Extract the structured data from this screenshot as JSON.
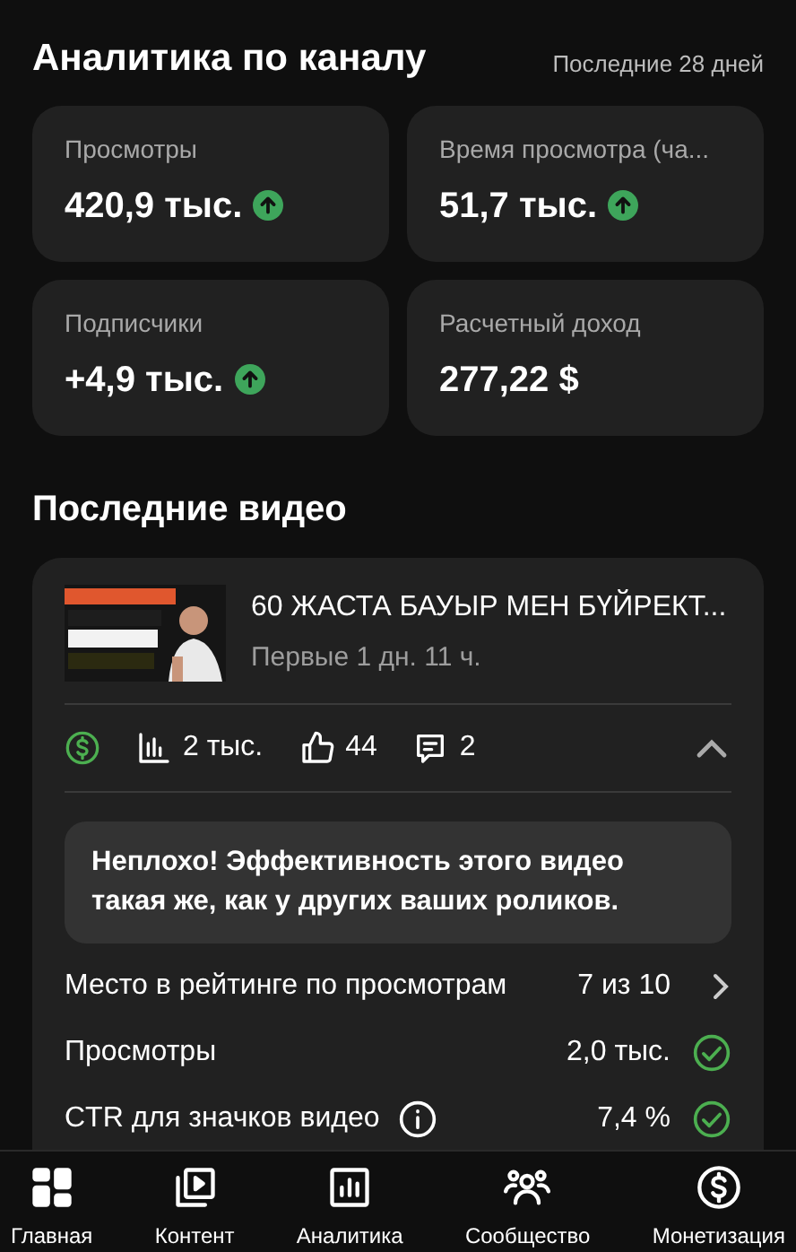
{
  "header": {
    "title": "Аналитика по каналу",
    "period": "Последние 28 дней"
  },
  "stats": [
    {
      "label": "Просмотры",
      "value": "420,9 тыс.",
      "kind": "rising"
    },
    {
      "label": "Время просмотра (ча...",
      "value": "51,7 тыс.",
      "kind": "rising"
    },
    {
      "label": "Подписчики",
      "value": "+4,9 тыс.",
      "kind": "rising"
    },
    {
      "label": "Расчетный доход",
      "value": "277,22 $",
      "kind": "plain"
    }
  ],
  "recent": {
    "title": "Последние видео",
    "video": {
      "title": "60 ЖАСТА БАУЫР МЕН БҮЙРЕКТ...",
      "subtitle": "Первые 1 дн. 11 ч.",
      "metrics": [
        {
          "kind": "views",
          "value": "2 тыс."
        },
        {
          "kind": "likes",
          "value": "44"
        },
        {
          "kind": "comments",
          "value": "2"
        }
      ],
      "expanded": true,
      "note": "Неплохо! Эффективность этого видео такая же, как у других ваших роликов.",
      "rows": [
        {
          "kind": "link",
          "label": "Место в рейтинге по просмотрам",
          "value": "7 из 10"
        },
        {
          "kind": "check",
          "label": "Просмотры",
          "value": "2,0 тыс."
        },
        {
          "kind": "check-info",
          "label": "CTR для значков видео",
          "value": "7,4 %"
        }
      ]
    }
  },
  "nav": [
    {
      "kind": "home",
      "label": "Главная"
    },
    {
      "kind": "content",
      "label": "Контент"
    },
    {
      "kind": "analytics",
      "label": "Аналитика"
    },
    {
      "kind": "community",
      "label": "Сообщество"
    },
    {
      "kind": "money",
      "label": "Монетизация"
    }
  ]
}
